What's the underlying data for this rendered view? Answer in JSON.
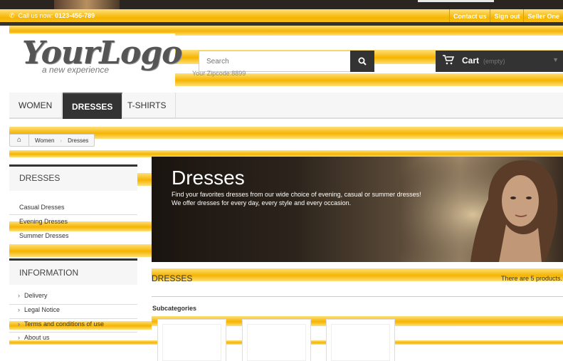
{
  "header": {
    "call_prefix": "Call us now:",
    "phone": "0123-456-789",
    "phone_icon": "phone-icon",
    "links": [
      "Contact us",
      "Sign out",
      "Seller One"
    ]
  },
  "logo": {
    "main": "YourLogo",
    "tagline": "a new experience"
  },
  "search": {
    "placeholder": "Search",
    "button_icon": "search-icon",
    "zipcode": "Your Zipcode:8899"
  },
  "cart": {
    "icon": "shopping-cart-icon",
    "label": "Cart",
    "status": "(empty)",
    "caret_icon": "caret-down-icon"
  },
  "menu": {
    "items": [
      "WOMEN",
      "DRESSES",
      "T-SHIRTS"
    ],
    "active": "DRESSES"
  },
  "breadcrumb": {
    "home_icon": "home-icon",
    "items": [
      "Women",
      "Dresses"
    ]
  },
  "sidebar": {
    "dresses": {
      "title": "DRESSES",
      "items": [
        "Casual Dresses",
        "Evening Dresses",
        "Summer Dresses"
      ]
    },
    "information": {
      "title": "INFORMATION",
      "items": [
        "Delivery",
        "Legal Notice",
        "Terms and conditions of use",
        "About us"
      ]
    }
  },
  "banner": {
    "title": "Dresses",
    "line1": "Find your favorites dresses from our wide choice of evening, casual or summer dresses!",
    "line2": "We offer dresses for every day, every style and every occasion."
  },
  "category": {
    "heading": "DRESSES",
    "count": "There are 5 products.",
    "subcategories_label": "Subcategories"
  },
  "colors": {
    "accent_yellow": "#f6b400",
    "dark": "#333333"
  }
}
